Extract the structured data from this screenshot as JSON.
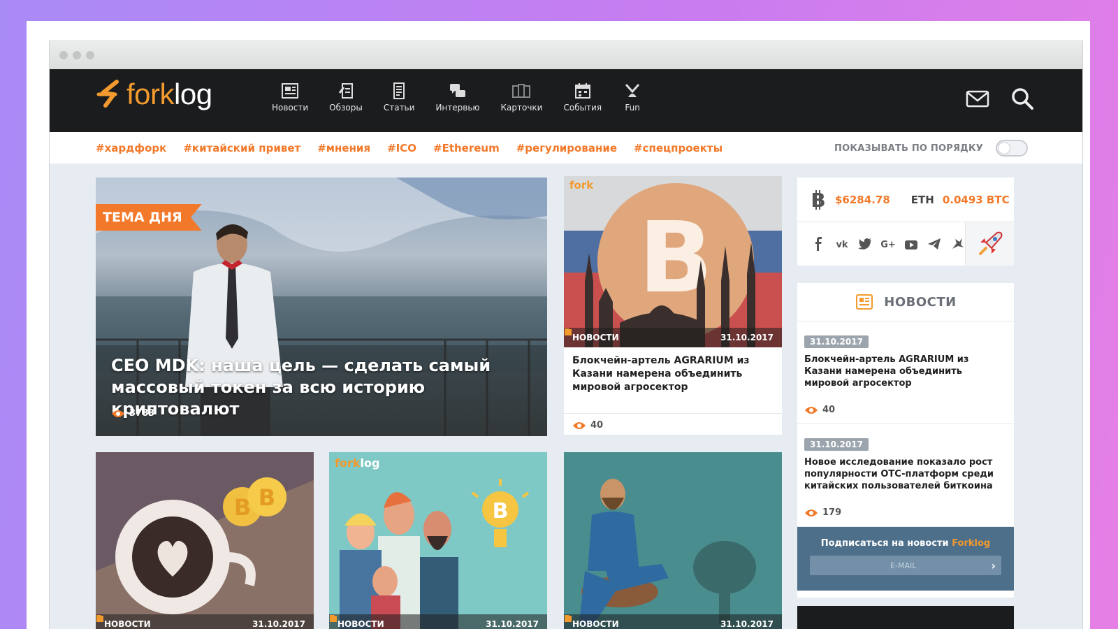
{
  "logo": {
    "part1": "fork",
    "part2": "log"
  },
  "nav": [
    {
      "label": "Новости",
      "icon": "newspaper-icon"
    },
    {
      "label": "Обзоры",
      "icon": "review-icon"
    },
    {
      "label": "Статьи",
      "icon": "article-icon"
    },
    {
      "label": "Интервью",
      "icon": "chat-icon"
    },
    {
      "label": "Карточки",
      "icon": "cards-icon"
    },
    {
      "label": "События",
      "icon": "calendar-icon"
    },
    {
      "label": "Fun",
      "icon": "fun-icon"
    }
  ],
  "tags": [
    "#хардфорк",
    "#китайский привет",
    "#мнения",
    "#ICO",
    "#Ethereum",
    "#регулирование",
    "#спецпроекты"
  ],
  "sort_label": "ПОКАЗЫВАТЬ ПО ПОРЯДКУ",
  "feature": {
    "badge": "ТЕМА ДНЯ",
    "title": "CEO MDK: наша цель — сделать самый массовый токен за всю историю криптовалют",
    "views": "3783"
  },
  "card_main": {
    "watermark": "fork",
    "category": "НОВОСТИ",
    "date": "31.10.2017",
    "title": "Блокчейн-артель AGRARIUM из Казани намерена объединить мировой агросектор",
    "views": "40"
  },
  "bottom_cards": [
    {
      "category": "НОВОСТИ",
      "date": "31.10.2017"
    },
    {
      "category": "НОВОСТИ",
      "date": "31.10.2017",
      "watermark_fork": "fork",
      "watermark_log": "log"
    },
    {
      "category": "НОВОСТИ",
      "date": "31.10.2017"
    }
  ],
  "ticker": {
    "btc_price": "$6284.78",
    "eth_label": "ETH",
    "eth_value": "0.0493 BTC"
  },
  "news_box": {
    "heading": "НОВОСТИ",
    "items": [
      {
        "date": "31.10.2017",
        "title": "Блокчейн-артель AGRARIUM из Казани намерена объединить мировой агросектор",
        "views": "40"
      },
      {
        "date": "31.10.2017",
        "title": "Новое исследование показало рост популярности OTC-платформ среди китайских пользователей биткоина",
        "views": "179"
      }
    ],
    "subscribe_text": "Подписаться на новости",
    "subscribe_brand": "Forklog",
    "email_placeholder": "E-MAIL"
  },
  "colors": {
    "accent": "#f2792a",
    "dark": "#1b1c1e",
    "subscribe_bg": "#4d6f8a"
  }
}
